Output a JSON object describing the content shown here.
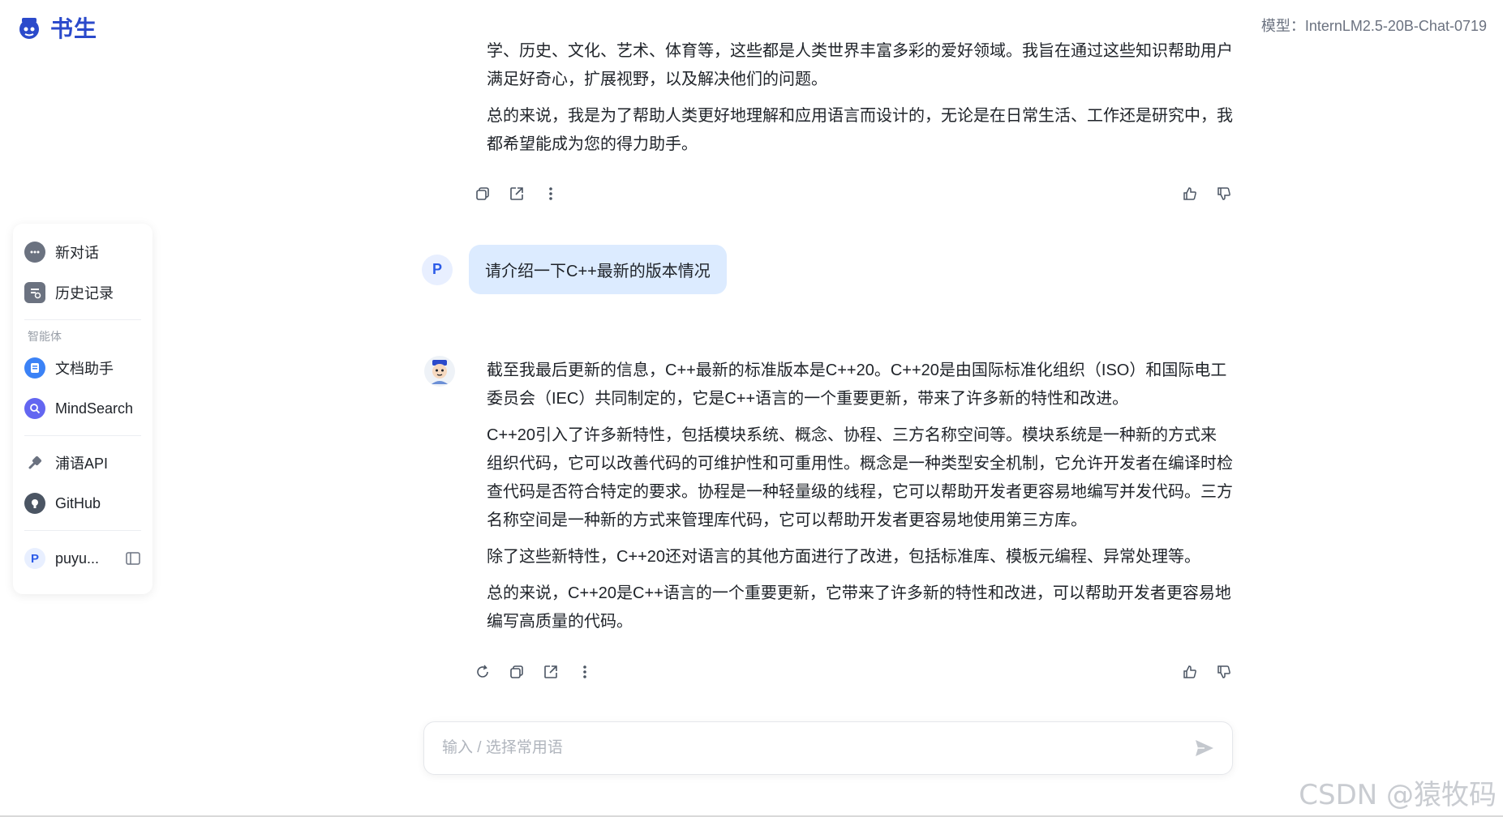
{
  "header": {
    "logo_text": "书生",
    "model_label": "模型：InternLM2.5-20B-Chat-0719"
  },
  "sidebar": {
    "new_chat": "新对话",
    "history": "历史记录",
    "section_agents": "智能体",
    "doc_assistant": "文档助手",
    "mindsearch": "MindSearch",
    "puyu_api": "浦语API",
    "github": "GitHub",
    "user_initial": "P",
    "user_name": "puyu..."
  },
  "chat": {
    "prev_reply": [
      "学、历史、文化、艺术、体育等，这些都是人类世界丰富多彩的爱好领域。我旨在通过这些知识帮助用户满足好奇心，扩展视野，以及解决他们的问题。",
      "总的来说，我是为了帮助人类更好地理解和应用语言而设计的，无论是在日常生活、工作还是研究中，我都希望能成为您的得力助手。"
    ],
    "user_initial": "P",
    "user_message": "请介绍一下C++最新的版本情况",
    "bot_reply": [
      "截至我最后更新的信息，C++最新的标准版本是C++20。C++20是由国际标准化组织（ISO）和国际电工委员会（IEC）共同制定的，它是C++语言的一个重要更新，带来了许多新的特性和改进。",
      "C++20引入了许多新特性，包括模块系统、概念、协程、三方名称空间等。模块系统是一种新的方式来组织代码，它可以改善代码的可维护性和可重用性。概念是一种类型安全机制，它允许开发者在编译时检查代码是否符合特定的要求。协程是一种轻量级的线程，它可以帮助开发者更容易地编写并发代码。三方名称空间是一种新的方式来管理库代码，它可以帮助开发者更容易地使用第三方库。",
      "除了这些新特性，C++20还对语言的其他方面进行了改进，包括标准库、模板元编程、异常处理等。",
      "总的来说，C++20是C++语言的一个重要更新，它带来了许多新的特性和改进，可以帮助开发者更容易地编写高质量的代码。"
    ]
  },
  "input": {
    "placeholder": "输入 / 选择常用语"
  },
  "watermark": "CSDN @猿牧码",
  "colors": {
    "brand": "#2b4acb",
    "bubble": "#dcebff",
    "accent": "#2b5be8"
  }
}
